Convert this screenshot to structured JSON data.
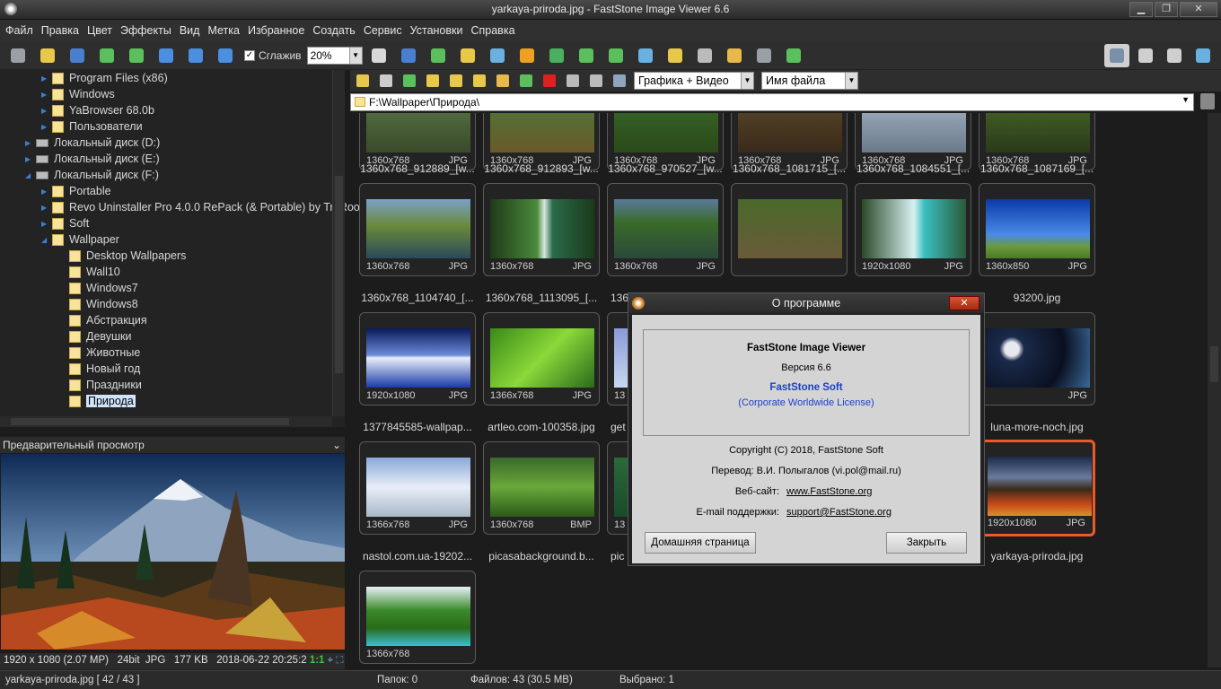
{
  "window": {
    "title": "yarkaya-priroda.jpg  -  FastStone Image Viewer 6.6"
  },
  "menu": [
    "Файл",
    "Правка",
    "Цвет",
    "Эффекты",
    "Вид",
    "Метка",
    "Избранное",
    "Создать",
    "Сервис",
    "Установки",
    "Справка"
  ],
  "toolbar": {
    "smooth_label": "Сглажив",
    "smooth_checked": "✓",
    "zoom_value": "20%"
  },
  "tree": {
    "items": [
      {
        "label": "Program Files (x86)",
        "kind": "folder"
      },
      {
        "label": "Windows",
        "kind": "folder"
      },
      {
        "label": "YaBrowser 68.0b",
        "kind": "folder"
      },
      {
        "label": "Пользователи",
        "kind": "folder"
      },
      {
        "label": "Локальный диск (D:)",
        "kind": "drive"
      },
      {
        "label": "Локальный диск (E:)",
        "kind": "drive"
      },
      {
        "label": "Локальный диск (F:)",
        "kind": "drive"
      },
      {
        "label": "Portable",
        "kind": "folder"
      },
      {
        "label": "Revo Uninstaller Pro 4.0.0 RePack (& Portable) by TryRooM",
        "kind": "folder"
      },
      {
        "label": "Soft",
        "kind": "folder"
      },
      {
        "label": "Wallpaper",
        "kind": "folder"
      },
      {
        "label": "Desktop Wallpapers",
        "kind": "folder"
      },
      {
        "label": "Wall10",
        "kind": "folder"
      },
      {
        "label": "Windows7",
        "kind": "folder"
      },
      {
        "label": "Windows8",
        "kind": "folder"
      },
      {
        "label": "Абстракция",
        "kind": "folder"
      },
      {
        "label": "Девушки",
        "kind": "folder"
      },
      {
        "label": "Животные",
        "kind": "folder"
      },
      {
        "label": "Новый год",
        "kind": "folder"
      },
      {
        "label": "Праздники",
        "kind": "folder"
      },
      {
        "label": "Природа",
        "kind": "folder",
        "selected": true
      }
    ]
  },
  "preview": {
    "header": "Предварительный просмотр",
    "status": {
      "dims": "1920 x 1080 (2.07 MP)",
      "depth": "24bit",
      "type": "JPG",
      "size": "177 KB",
      "date": "2018-06-22 20:25:2",
      "ratio": "1:1"
    }
  },
  "nav": {
    "filter": "Графика +   Видео",
    "sort": "Имя файла"
  },
  "path": "F:\\Wallpaper\\Природа\\",
  "thumbnails": [
    {
      "size": "1360x768",
      "type": "JPG",
      "name": "1360x768_912889_[w..."
    },
    {
      "size": "1360x768",
      "type": "JPG",
      "name": "1360x768_912893_[w..."
    },
    {
      "size": "1360x768",
      "type": "JPG",
      "name": "1360x768_970527_[w..."
    },
    {
      "size": "1360x768",
      "type": "JPG",
      "name": "1360x768_1081715_[..."
    },
    {
      "size": "1360x768",
      "type": "JPG",
      "name": "1360x768_1084551_[..."
    },
    {
      "size": "1360x768",
      "type": "JPG",
      "name": "1360x768_1087169_[..."
    },
    {
      "size": "1360x768",
      "type": "JPG",
      "name": "1360x768_1104740_[..."
    },
    {
      "size": "1360x768",
      "type": "JPG",
      "name": "1360x768_1113095_[..."
    },
    {
      "size": "1360x768",
      "type": "JPG",
      "name": "136"
    },
    {
      "size": "",
      "type": "",
      "name": ""
    },
    {
      "size": "1920x1080",
      "type": "JPG",
      "name": ""
    },
    {
      "size": "1360x850",
      "type": "JPG",
      "name": "93200.jpg"
    },
    {
      "size": "1920x1080",
      "type": "JPG",
      "name": "1377845585-wallpap..."
    },
    {
      "size": "1366x768",
      "type": "JPG",
      "name": "artleo.com-100358.jpg"
    },
    {
      "size": "13",
      "type": "",
      "name": "get"
    },
    {
      "size": "",
      "type": "",
      "name": ""
    },
    {
      "size": "",
      "type": "",
      "name": ""
    },
    {
      "size": "",
      "type": "JPG",
      "name": "luna-more-noch.jpg"
    },
    {
      "size": "1366x768",
      "type": "JPG",
      "name": "nastol.com.ua-19202..."
    },
    {
      "size": "1360x768",
      "type": "BMP",
      "name": "picasabackground.b..."
    },
    {
      "size": "13",
      "type": "",
      "name": "pic"
    },
    {
      "size": "",
      "type": "",
      "name": ""
    },
    {
      "size": "",
      "type": "",
      "name": ""
    },
    {
      "size": "1920x1080",
      "type": "JPG",
      "name": "yarkaya-priroda.jpg",
      "selected": true
    },
    {
      "size": "1366x768",
      "type": "",
      "name": ""
    }
  ],
  "status": {
    "file": "yarkaya-priroda.jpg [ 42 / 43 ]",
    "folders": "Папок: 0",
    "files": "Файлов: 43 (30.5 MB)",
    "selected": "Выбрано: 1"
  },
  "about": {
    "title": "О программе",
    "close": "✕",
    "product": "FastStone Image Viewer",
    "version": "Версия 6.6",
    "company": "FastStone Soft",
    "license": "(Corporate Worldwide License)",
    "copyright": "Copyright (C) 2018, FastStone Soft",
    "translation": "Перевод: В.И. Полыгалов (vi.pol@mail.ru)",
    "website_label": "Веб-сайт:",
    "website": "www.FastStone.org",
    "email_label": "E-mail поддержки:",
    "email": "support@FastStone.org",
    "home_button": "Домашняя страница",
    "close_button": "Закрыть"
  }
}
